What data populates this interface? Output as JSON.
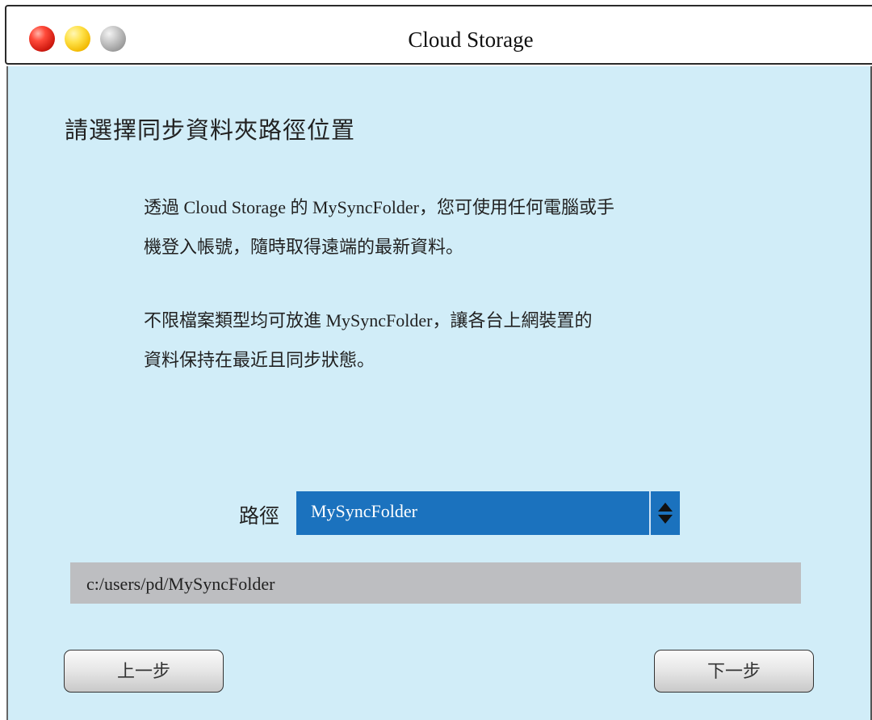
{
  "window": {
    "title": "Cloud Storage"
  },
  "wizard": {
    "heading": "請選擇同步資料夾路徑位置",
    "paragraph1_line1": "透過 Cloud Storage 的 MySyncFolder，您可使用任何電腦或手",
    "paragraph1_line2": "機登入帳號，隨時取得遠端的最新資料。",
    "paragraph2_line1": "不限檔案類型均可放進 MySyncFolder，讓各台上網裝置的",
    "paragraph2_line2": "資料保持在最近且同步狀態。"
  },
  "path": {
    "label": "路徑",
    "selected": "MySyncFolder",
    "full_path": "c:/users/pd/MySyncFolder"
  },
  "buttons": {
    "prev_label": "上一步",
    "next_label": "下一步"
  },
  "icons": {
    "close": "red-circle-icon",
    "minimize": "yellow-circle-icon",
    "zoom": "gray-circle-icon",
    "select_arrows": "up-down-arrows-icon"
  },
  "colors": {
    "content_bg": "#d1edf8",
    "select_bg": "#1b72be",
    "path_display_bg": "#bdbec1"
  }
}
